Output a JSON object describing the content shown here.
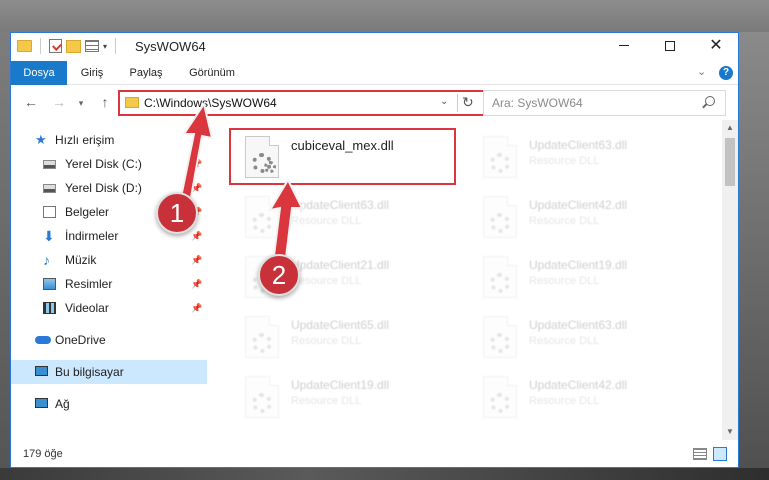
{
  "window": {
    "title": "SysWOW64"
  },
  "ribbon": {
    "tabs": [
      "Dosya",
      "Giriş",
      "Paylaş",
      "Görünüm"
    ],
    "help_label": "?"
  },
  "navigation": {
    "address": "C:\\Windows\\SysWOW64",
    "search_placeholder": "Ara: SysWOW64"
  },
  "sidebar": {
    "quick_access": "Hızlı erişim",
    "items": [
      {
        "label": "Yerel Disk (C:)",
        "icon": "drive-icon",
        "pinned": true
      },
      {
        "label": "Yerel Disk (D:)",
        "icon": "drive-icon",
        "pinned": true
      },
      {
        "label": "Belgeler",
        "icon": "documents-icon",
        "pinned": true
      },
      {
        "label": "İndirmeler",
        "icon": "downloads-icon",
        "pinned": true
      },
      {
        "label": "Müzik",
        "icon": "music-icon",
        "pinned": true
      },
      {
        "label": "Resimler",
        "icon": "pictures-icon",
        "pinned": true
      },
      {
        "label": "Videolar",
        "icon": "videos-icon",
        "pinned": true
      }
    ],
    "onedrive": "OneDrive",
    "this_pc": "Bu bilgisayar",
    "network": "Ağ"
  },
  "files": [
    {
      "name": "cubiceval_mex.dll",
      "type": "",
      "highlighted": true
    },
    {
      "name": "UpdateClient63.dll",
      "type": "Resource DLL"
    },
    {
      "name": "UpdateClient63.dll",
      "type": "Resource DLL"
    },
    {
      "name": "UpdateClient42.dll",
      "type": "Resource DLL"
    },
    {
      "name": "UpdateClient21.dll",
      "type": "Resource DLL"
    },
    {
      "name": "UpdateClient19.dll",
      "type": "Resource DLL"
    },
    {
      "name": "UpdateClient65.dll",
      "type": "Resource DLL"
    },
    {
      "name": "UpdateClient63.dll",
      "type": "Resource DLL"
    },
    {
      "name": "UpdateClient19.dll",
      "type": "Resource DLL"
    },
    {
      "name": "UpdateClient42.dll",
      "type": "Resource DLL"
    }
  ],
  "status": {
    "item_count": "179 öğe"
  },
  "annotations": {
    "step1": "1",
    "step2": "2"
  },
  "colors": {
    "accent": "#1979ca",
    "highlight_red": "#d9363e",
    "selection": "#cce8ff"
  }
}
